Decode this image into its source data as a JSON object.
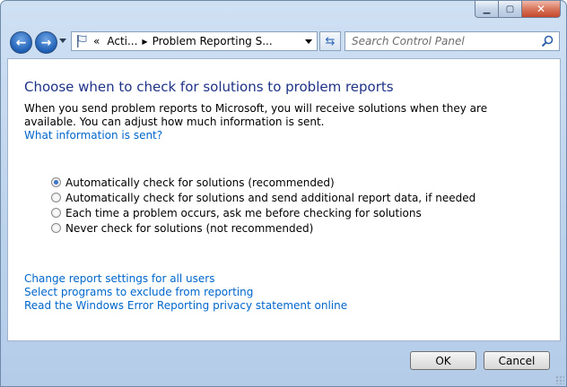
{
  "window": {
    "caption_buttons": {
      "minimize_icon": "minimize-icon",
      "maximize_icon": "maximize-icon",
      "close_icon": "close-icon"
    }
  },
  "nav": {
    "back_icon": "back-arrow-icon",
    "forward_icon": "forward-arrow-icon",
    "address": {
      "overflow": "«",
      "crumbs": [
        "Acti...",
        "Problem Reporting S..."
      ]
    },
    "refresh_icon": "refresh-icon",
    "search": {
      "placeholder": "Search Control Panel"
    }
  },
  "main": {
    "title": "Choose when to check for solutions to problem reports",
    "description": "When you send problem reports to Microsoft, you will receive solutions when they are available. You can adjust how much information is sent.",
    "what_link": "What information is sent?",
    "options": [
      {
        "label": "Automatically check for solutions (recommended)",
        "selected": true
      },
      {
        "label": "Automatically check for solutions and send additional report data, if needed",
        "selected": false
      },
      {
        "label": "Each time a problem occurs, ask me before checking for solutions",
        "selected": false
      },
      {
        "label": "Never check for solutions (not recommended)",
        "selected": false
      }
    ],
    "links": [
      "Change report settings for all users",
      "Select programs to exclude from reporting",
      "Read the Windows Error Reporting privacy statement online"
    ]
  },
  "footer": {
    "ok_label": "OK",
    "cancel_label": "Cancel"
  },
  "colors": {
    "title_text": "#1e3287",
    "link": "#0066cc",
    "frame": "#bcd3ec"
  }
}
